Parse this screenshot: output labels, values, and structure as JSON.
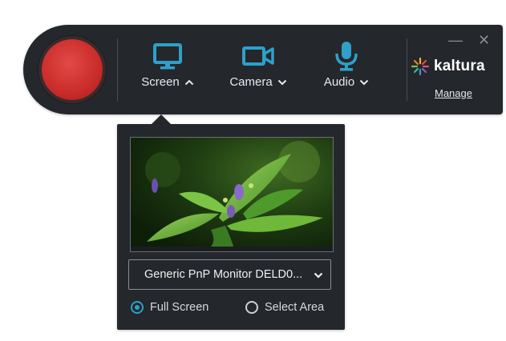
{
  "toolbar": {
    "tools": {
      "screen": {
        "label": "Screen",
        "icon": "monitor-icon",
        "expanded": true
      },
      "camera": {
        "label": "Camera",
        "icon": "video-camera-icon",
        "expanded": false
      },
      "audio": {
        "label": "Audio",
        "icon": "microphone-icon",
        "expanded": false
      }
    },
    "window_controls": {
      "minimize": "—",
      "close": "✕"
    },
    "brand": {
      "name": "kaltura",
      "manage_label": "Manage"
    }
  },
  "screen_panel": {
    "source_select": {
      "selected": "Generic PnP Monitor DELD0..."
    },
    "options": [
      {
        "label": "Full Screen",
        "checked": true
      },
      {
        "label": "Select Area",
        "checked": false
      }
    ]
  },
  "colors": {
    "toolbar_bg": "#24272c",
    "accent": "#2ea0c9",
    "record": "#c92c2a"
  }
}
